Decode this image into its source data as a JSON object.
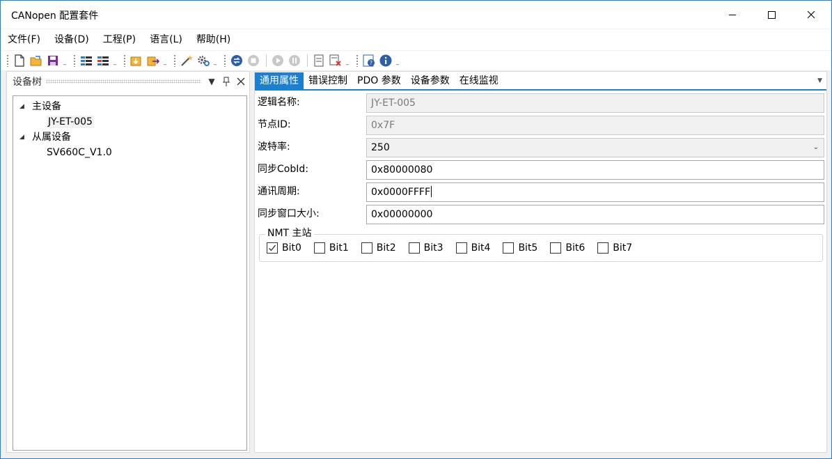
{
  "window": {
    "title": "CANopen 配置套件"
  },
  "menu": [
    "文件(F)",
    "设备(D)",
    "工程(P)",
    "语言(L)",
    "帮助(H)"
  ],
  "toolbar": {
    "icons": [
      "new-file-icon",
      "open-folder-icon",
      "save-icon",
      "config-list-icon",
      "config-list-remove-icon",
      "import-icon",
      "export-icon",
      "magic-wand-icon",
      "settings-icon",
      "connect-icon",
      "stop-icon",
      "play-icon",
      "pause-icon",
      "save-device-icon",
      "delete-device-icon",
      "help-icon",
      "info-icon"
    ]
  },
  "left_panel": {
    "title": "设备树",
    "tree": [
      {
        "label": "主设备",
        "children": [
          "JY-ET-005"
        ]
      },
      {
        "label": "从属设备",
        "children": [
          "SV660C_V1.0"
        ]
      }
    ]
  },
  "tabs": [
    "通用属性",
    "错误控制",
    "PDO 参数",
    "设备参数",
    "在线监视"
  ],
  "properties": [
    {
      "label": "逻辑名称:",
      "value": "JY-ET-005",
      "kind": "disabled"
    },
    {
      "label": "节点ID:",
      "value": "0x7F",
      "kind": "disabled"
    },
    {
      "label": "波特率:",
      "value": "250",
      "kind": "select"
    },
    {
      "label": "同步CobId:",
      "value": "0x80000080",
      "kind": "input"
    },
    {
      "label": "通讯周期:",
      "value": "0x0000FFFF",
      "kind": "input"
    },
    {
      "label": "同步窗口大小:",
      "value": "0x00000000",
      "kind": "input"
    }
  ],
  "nmt": {
    "title": "NMT 主站",
    "bits": [
      {
        "label": "Bit0",
        "checked": true
      },
      {
        "label": "Bit1",
        "checked": false
      },
      {
        "label": "Bit2",
        "checked": false
      },
      {
        "label": "Bit3",
        "checked": false
      },
      {
        "label": "Bit4",
        "checked": false
      },
      {
        "label": "Bit5",
        "checked": false
      },
      {
        "label": "Bit6",
        "checked": false
      },
      {
        "label": "Bit7",
        "checked": false
      }
    ]
  }
}
